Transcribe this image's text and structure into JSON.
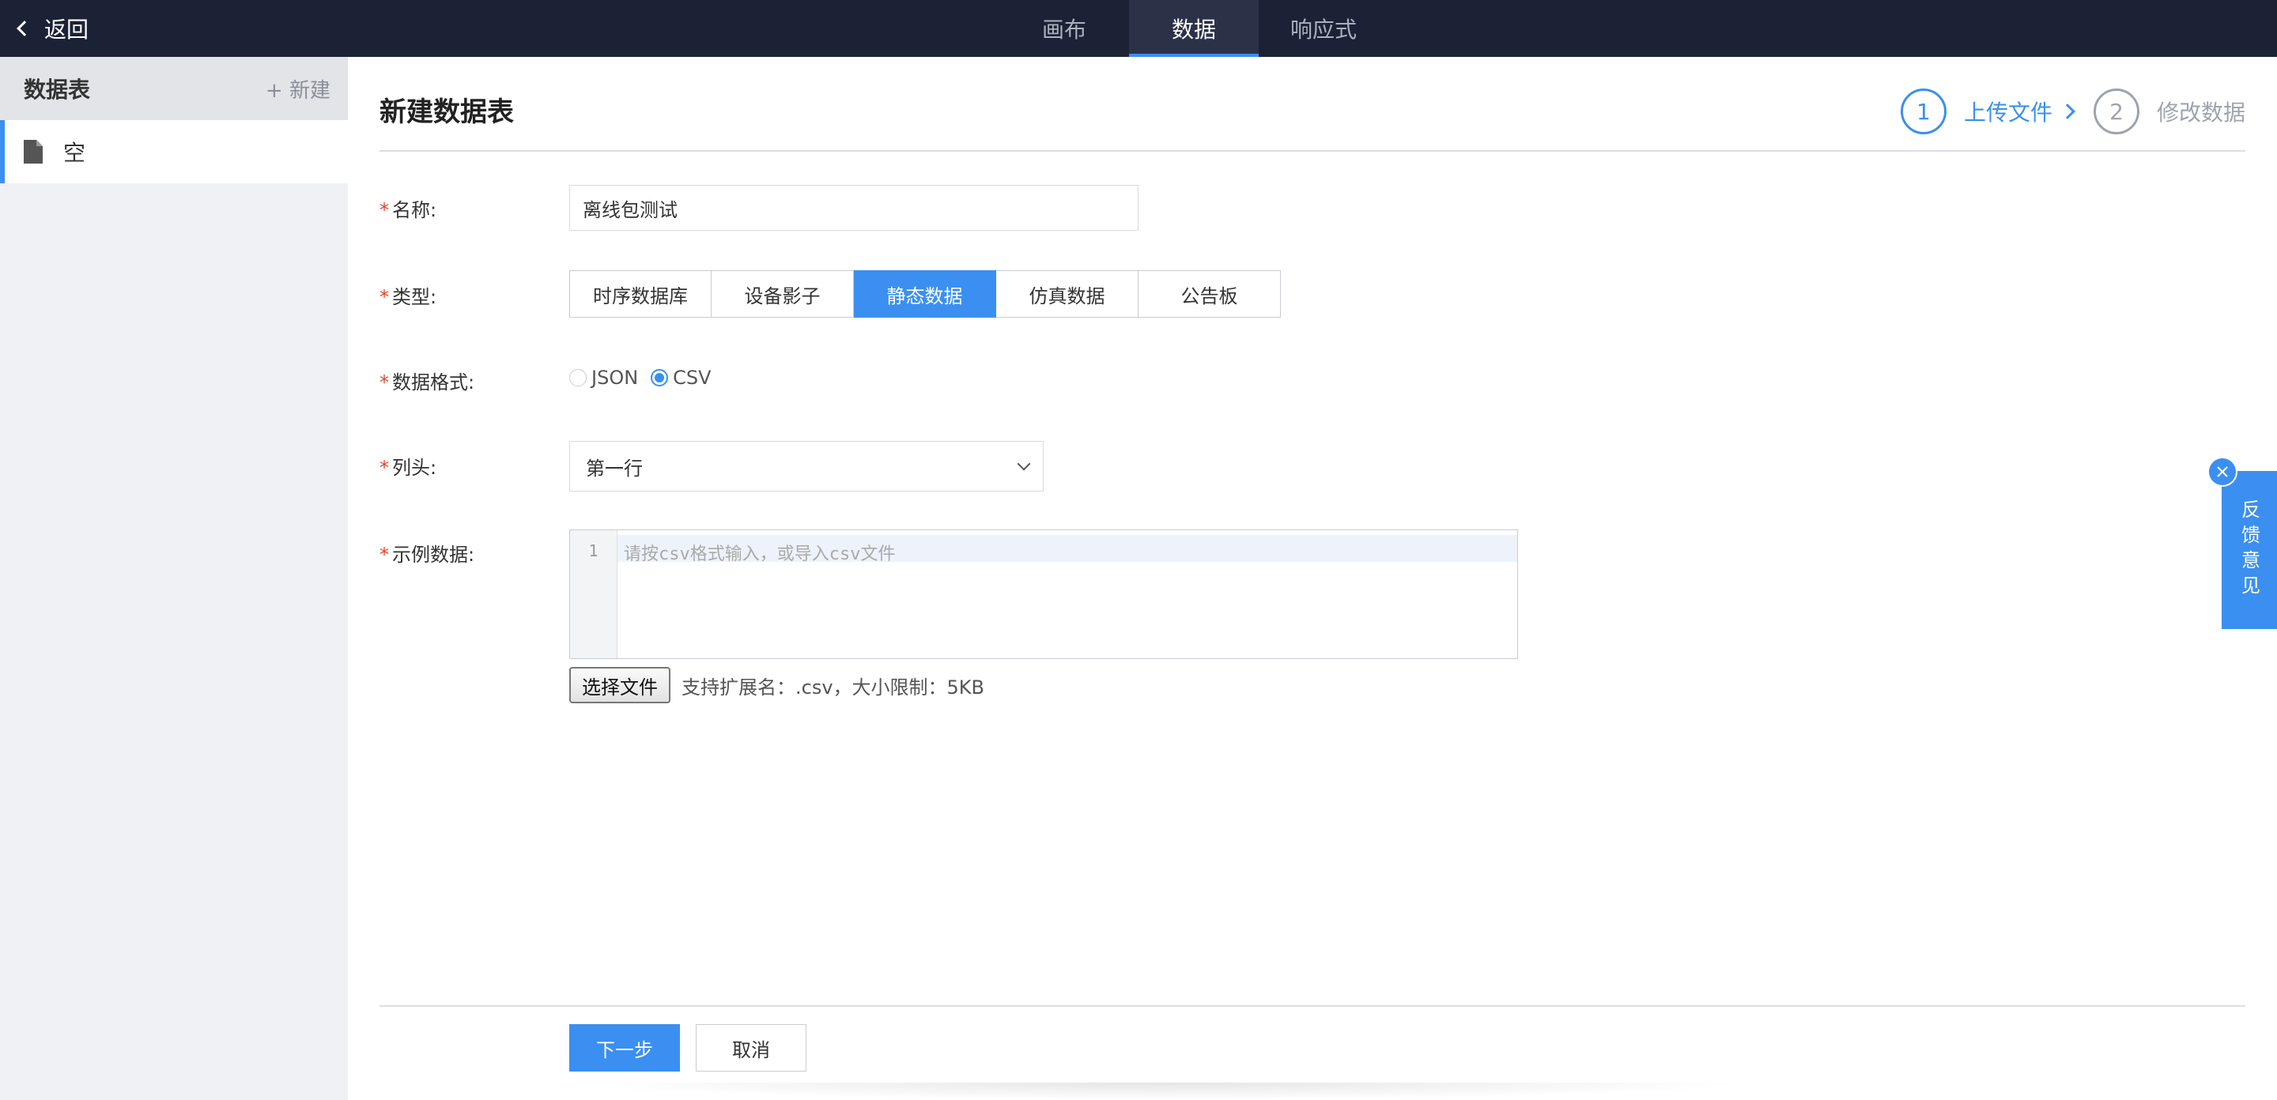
{
  "topbar": {
    "back_label": "返回",
    "tabs": [
      {
        "label": "画布",
        "active": false
      },
      {
        "label": "数据",
        "active": true
      },
      {
        "label": "响应式",
        "active": false
      }
    ]
  },
  "sidebar": {
    "title": "数据表",
    "new_label": "+ 新建",
    "items": [
      {
        "label": "空",
        "icon": "file-icon",
        "active": true
      }
    ]
  },
  "main": {
    "title": "新建数据表",
    "steps": [
      {
        "number": "1",
        "label": "上传文件",
        "active": true
      },
      {
        "number": "2",
        "label": "修改数据",
        "active": false
      }
    ],
    "form": {
      "name_label": "名称:",
      "name_value": "离线包测试",
      "type_label": "类型:",
      "type_options": [
        "时序数据库",
        "设备影子",
        "静态数据",
        "仿真数据",
        "公告板"
      ],
      "type_selected": "静态数据",
      "format_label": "数据格式:",
      "format_options": [
        "JSON",
        "CSV"
      ],
      "format_selected": "CSV",
      "header_label": "列头:",
      "header_value": "第一行",
      "sample_label": "示例数据:",
      "editor_line_number": "1",
      "editor_placeholder": "请按csv格式输入，或导入csv文件",
      "file_button": "选择文件",
      "file_hint": "支持扩展名：.csv，大小限制：5KB"
    },
    "buttons": {
      "next": "下一步",
      "cancel": "取消"
    }
  },
  "feedback": {
    "label": "反馈意见"
  },
  "colors": {
    "accent": "#3b8ff0",
    "topbar_bg": "#1c2235",
    "required": "#e5432c"
  }
}
